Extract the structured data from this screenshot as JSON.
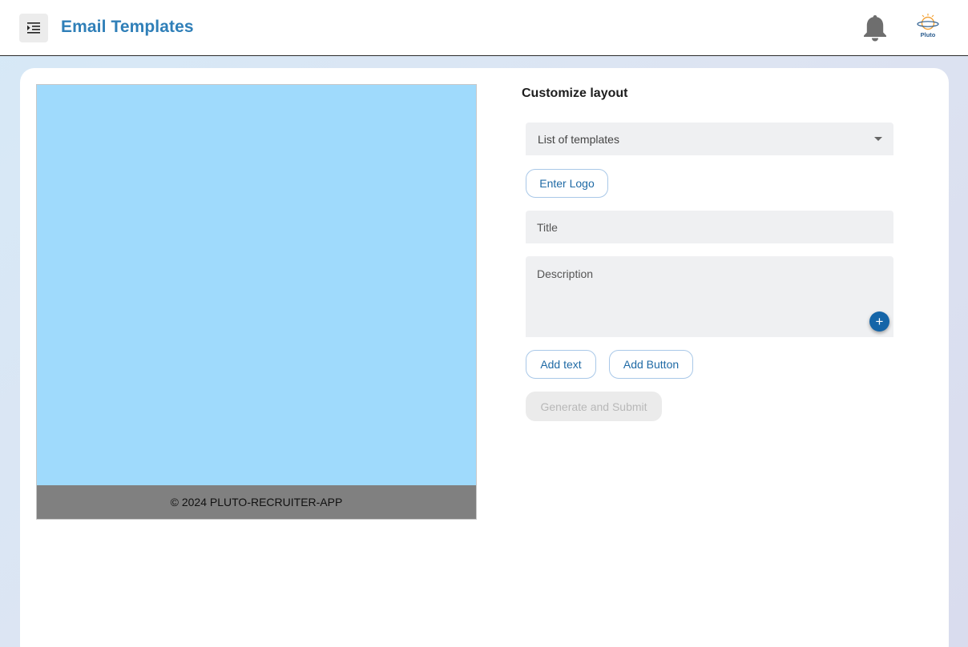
{
  "header": {
    "title": "Email Templates",
    "menu_icon": "menu-indent-icon",
    "notification_icon": "bell-icon",
    "logo_text": "Pluto"
  },
  "preview": {
    "background_color": "#9fdafc",
    "footer_text": "© 2024 PLUTO-RECRUITER-APP"
  },
  "customize": {
    "title": "Customize layout",
    "template_select": {
      "value": "List of templates"
    },
    "enter_logo_label": "Enter Logo",
    "title_field": {
      "placeholder": "Title"
    },
    "description_field": {
      "placeholder": "Description"
    },
    "add_icon": "plus-icon",
    "add_text_label": "Add text",
    "add_button_label": "Add Button",
    "submit_label": "Generate and Submit"
  },
  "colors": {
    "accent": "#2f7fb8",
    "primary": "#1565a8"
  }
}
